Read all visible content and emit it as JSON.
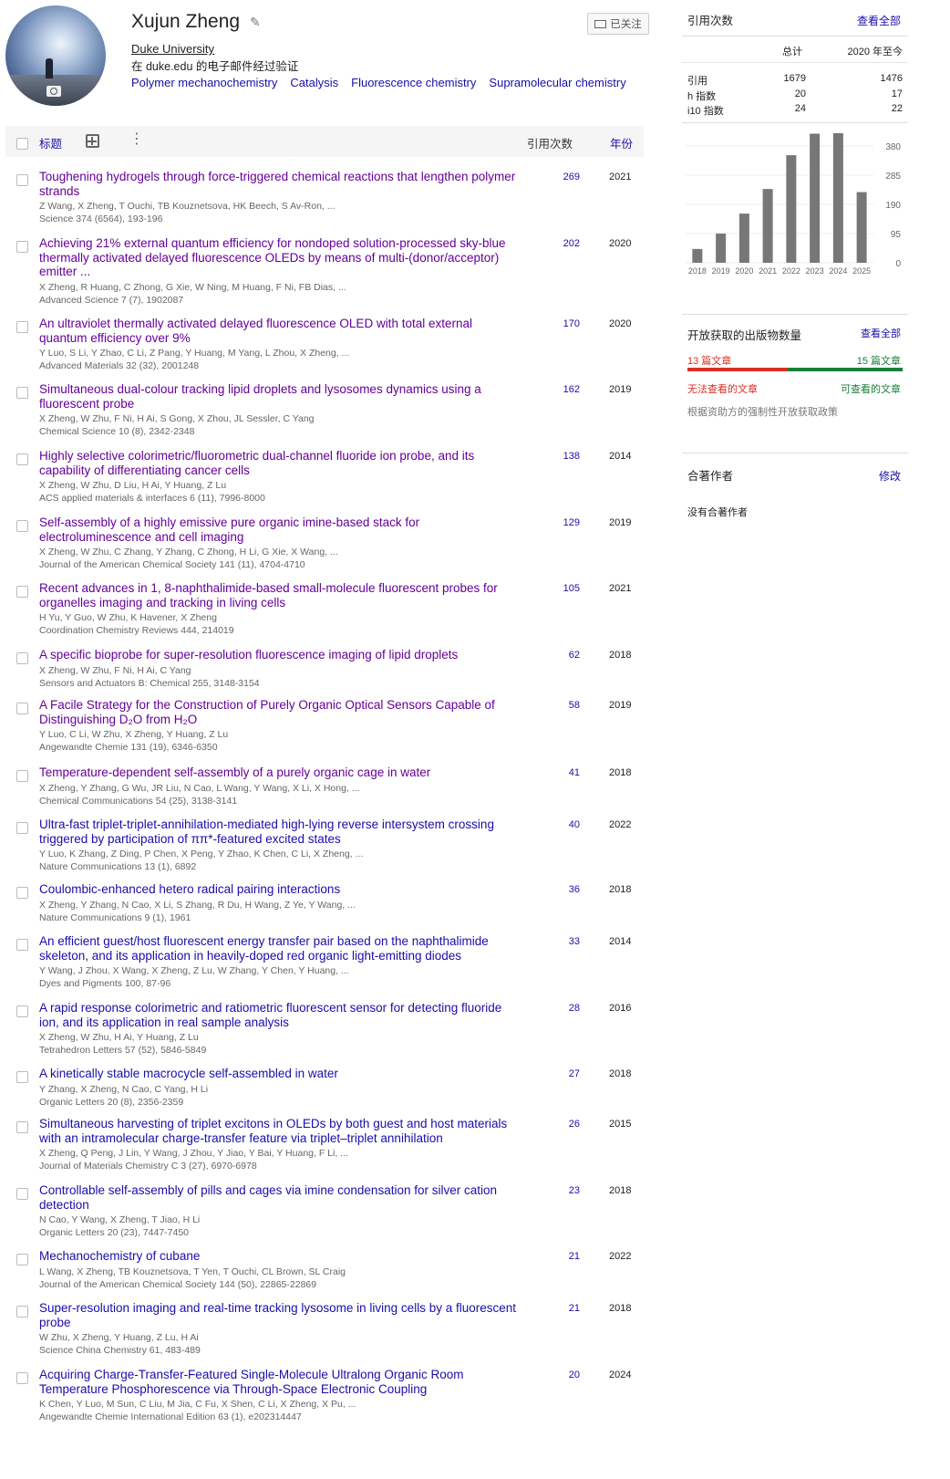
{
  "profile": {
    "name": "Xujun Zheng",
    "affiliation": "Duke University",
    "verified_email": "在 duke.edu 的电子邮件经过验证",
    "interests": [
      "Polymer mechanochemistry",
      "Catalysis",
      "Fluorescence chemistry",
      "Supramolecular chemistry"
    ],
    "follow_label": "已关注"
  },
  "table": {
    "title_header": "标题",
    "cited_header": "引用次数",
    "year_header": "年份"
  },
  "articles": [
    {
      "title": "Toughening hydrogels through force-triggered chemical reactions that lengthen polymer strands",
      "authors": "Z Wang, X Zheng, T Ouchi, TB Kouznetsova, HK Beech, S Av-Ron, ...",
      "venue": "Science 374 (6564), 193-196",
      "cites": "269",
      "year": "2021",
      "visited": true
    },
    {
      "title": "Achieving 21% external quantum efficiency for nondoped solution-processed sky-blue thermally activated delayed fluorescence OLEDs by means of multi-(donor/acceptor) emitter ...",
      "authors": "X Zheng, R Huang, C Zhong, G Xie, W Ning, M Huang, F Ni, FB Dias, ...",
      "venue": "Advanced Science 7 (7), 1902087",
      "cites": "202",
      "year": "2020",
      "visited": true
    },
    {
      "title": "An ultraviolet thermally activated delayed fluorescence OLED with total external quantum efficiency over 9%",
      "authors": "Y Luo, S Li, Y Zhao, C Li, Z Pang, Y Huang, M Yang, L Zhou, X Zheng, ...",
      "venue": "Advanced Materials 32 (32), 2001248",
      "cites": "170",
      "year": "2020",
      "visited": true
    },
    {
      "title": "Simultaneous dual-colour tracking lipid droplets and lysosomes dynamics using a fluorescent probe",
      "authors": "X Zheng, W Zhu, F Ni, H Ai, S Gong, X Zhou, JL Sessler, C Yang",
      "venue": "Chemical Science 10 (8), 2342-2348",
      "cites": "162",
      "year": "2019",
      "visited": true
    },
    {
      "title": "Highly selective colorimetric/fluorometric dual-channel fluoride ion probe, and its capability of differentiating cancer cells",
      "authors": "X Zheng, W Zhu, D Liu, H Ai, Y Huang, Z Lu",
      "venue": "ACS applied materials & interfaces 6 (11), 7996-8000",
      "cites": "138",
      "year": "2014",
      "visited": true
    },
    {
      "title": "Self-assembly of a highly emissive pure organic imine-based stack for electroluminescence and cell imaging",
      "authors": "X Zheng, W Zhu, C Zhang, Y Zhang, C Zhong, H Li, G Xie, X Wang, ...",
      "venue": "Journal of the American Chemical Society 141 (11), 4704-4710",
      "cites": "129",
      "year": "2019",
      "visited": true
    },
    {
      "title": "Recent advances in 1, 8-naphthalimide-based small-molecule fluorescent probes for organelles imaging and tracking in living cells",
      "authors": "H Yu, Y Guo, W Zhu, K Havener, X Zheng",
      "venue": "Coordination Chemistry Reviews 444, 214019",
      "cites": "105",
      "year": "2021",
      "visited": true
    },
    {
      "title": "A specific bioprobe for super-resolution fluorescence imaging of lipid droplets",
      "authors": "X Zheng, W Zhu, F Ni, H Ai, C Yang",
      "venue": "Sensors and Actuators B: Chemical 255, 3148-3154",
      "cites": "62",
      "year": "2018",
      "visited": true
    },
    {
      "title": "A Facile Strategy for the Construction of Purely Organic Optical Sensors Capable of Distinguishing D₂O from H₂O",
      "authors": "Y Luo, C Li, W Zhu, X Zheng, Y Huang, Z Lu",
      "venue": "Angewandte Chemie 131 (19), 6346-6350",
      "cites": "58",
      "year": "2019",
      "visited": true
    },
    {
      "title": "Temperature-dependent self-assembly of a purely organic cage in water",
      "authors": "X Zheng, Y Zhang, G Wu, JR Liu, N Cao, L Wang, Y Wang, X Li, X Hong, ...",
      "venue": "Chemical Communications 54 (25), 3138-3141",
      "cites": "41",
      "year": "2018",
      "visited": true
    },
    {
      "title": "Ultra-fast triplet-triplet-annihilation-mediated high-lying reverse intersystem crossing triggered by participation of ππ*-featured excited states",
      "authors": "Y Luo, K Zhang, Z Ding, P Chen, X Peng, Y Zhao, K Chen, C Li, X Zheng, ...",
      "venue": "Nature Communications 13 (1), 6892",
      "cites": "40",
      "year": "2022",
      "visited": false
    },
    {
      "title": "Coulombic-enhanced hetero radical pairing interactions",
      "authors": "X Zheng, Y Zhang, N Cao, X Li, S Zhang, R Du, H Wang, Z Ye, Y Wang, ...",
      "venue": "Nature Communications 9 (1), 1961",
      "cites": "36",
      "year": "2018",
      "visited": false
    },
    {
      "title": "An efficient guest/host fluorescent energy transfer pair based on the naphthalimide skeleton, and its application in heavily-doped red organic light-emitting diodes",
      "authors": "Y Wang, J Zhou, X Wang, X Zheng, Z Lu, W Zhang, Y Chen, Y Huang, ...",
      "venue": "Dyes and Pigments 100, 87-96",
      "cites": "33",
      "year": "2014",
      "visited": false
    },
    {
      "title": "A rapid response colorimetric and ratiometric fluorescent sensor for detecting fluoride ion, and its application in real sample analysis",
      "authors": "X Zheng, W Zhu, H Ai, Y Huang, Z Lu",
      "venue": "Tetrahedron Letters 57 (52), 5846-5849",
      "cites": "28",
      "year": "2016",
      "visited": false
    },
    {
      "title": "A kinetically stable macrocycle self-assembled in water",
      "authors": "Y Zhang, X Zheng, N Cao, C Yang, H Li",
      "venue": "Organic Letters 20 (8), 2356-2359",
      "cites": "27",
      "year": "2018",
      "visited": false
    },
    {
      "title": "Simultaneous harvesting of triplet excitons in OLEDs by both guest and host materials with an intramolecular charge-transfer feature via triplet–triplet annihilation",
      "authors": "X Zheng, Q Peng, J Lin, Y Wang, J Zhou, Y Jiao, Y Bai, Y Huang, F Li, ...",
      "venue": "Journal of Materials Chemistry C 3 (27), 6970-6978",
      "cites": "26",
      "year": "2015",
      "visited": false
    },
    {
      "title": "Controllable self-assembly of pills and cages via imine condensation for silver cation detection",
      "authors": "N Cao, Y Wang, X Zheng, T Jiao, H Li",
      "venue": "Organic Letters 20 (23), 7447-7450",
      "cites": "23",
      "year": "2018",
      "visited": false
    },
    {
      "title": "Mechanochemistry of cubane",
      "authors": "L Wang, X Zheng, TB Kouznetsova, T Yen, T Ouchi, CL Brown, SL Craig",
      "venue": "Journal of the American Chemical Society 144 (50), 22865-22869",
      "cites": "21",
      "year": "2022",
      "visited": false
    },
    {
      "title": "Super-resolution imaging and real-time tracking lysosome in living cells by a fluorescent probe",
      "authors": "W Zhu, X Zheng, Y Huang, Z Lu, H Ai",
      "venue": "Science China Chemistry 61, 483-489",
      "cites": "21",
      "year": "2018",
      "visited": false
    },
    {
      "title": "Acquiring Charge-Transfer-Featured Single-Molecule Ultralong Organic Room Temperature Phosphorescence via Through-Space Electronic Coupling",
      "authors": "K Chen, Y Luo, M Sun, C Liu, M Jia, C Fu, X Shen, C Li, X Zheng, X Pu, ...",
      "venue": "Angewandte Chemie International Edition 63 (1), e202314447",
      "cites": "20",
      "year": "2024",
      "visited": false
    }
  ],
  "stats": {
    "heading": "引用次数",
    "view_all": "查看全部",
    "col_total": "总计",
    "col_since": "2020 年至今",
    "rows": [
      {
        "label": "引用",
        "total": "1679",
        "since": "1476"
      },
      {
        "label": "h 指数",
        "total": "20",
        "since": "17"
      },
      {
        "label": "i10 指数",
        "total": "24",
        "since": "22"
      }
    ]
  },
  "chart_data": {
    "type": "bar",
    "categories": [
      "2018",
      "2019",
      "2020",
      "2021",
      "2022",
      "2023",
      "2024",
      "2025"
    ],
    "values": [
      45,
      95,
      160,
      240,
      350,
      420,
      480,
      230
    ],
    "yticks": [
      "0",
      "95",
      "190",
      "285",
      "380"
    ],
    "ylim": [
      0,
      480
    ],
    "bar_color": "#777777"
  },
  "open_access": {
    "heading": "开放获取的出版物数量",
    "view_all": "查看全部",
    "unavailable_count": "13 篇文章",
    "available_count": "15 篇文章",
    "unavailable_label": "无法查看的文章",
    "available_label": "可查看的文章",
    "note": "根据资助方的强制性开放获取政策",
    "unavailable": 13,
    "available": 15,
    "red": "#d93025",
    "green": "#188038"
  },
  "coauthors": {
    "heading": "合著作者",
    "edit": "修改",
    "empty": "没有合著作者"
  }
}
